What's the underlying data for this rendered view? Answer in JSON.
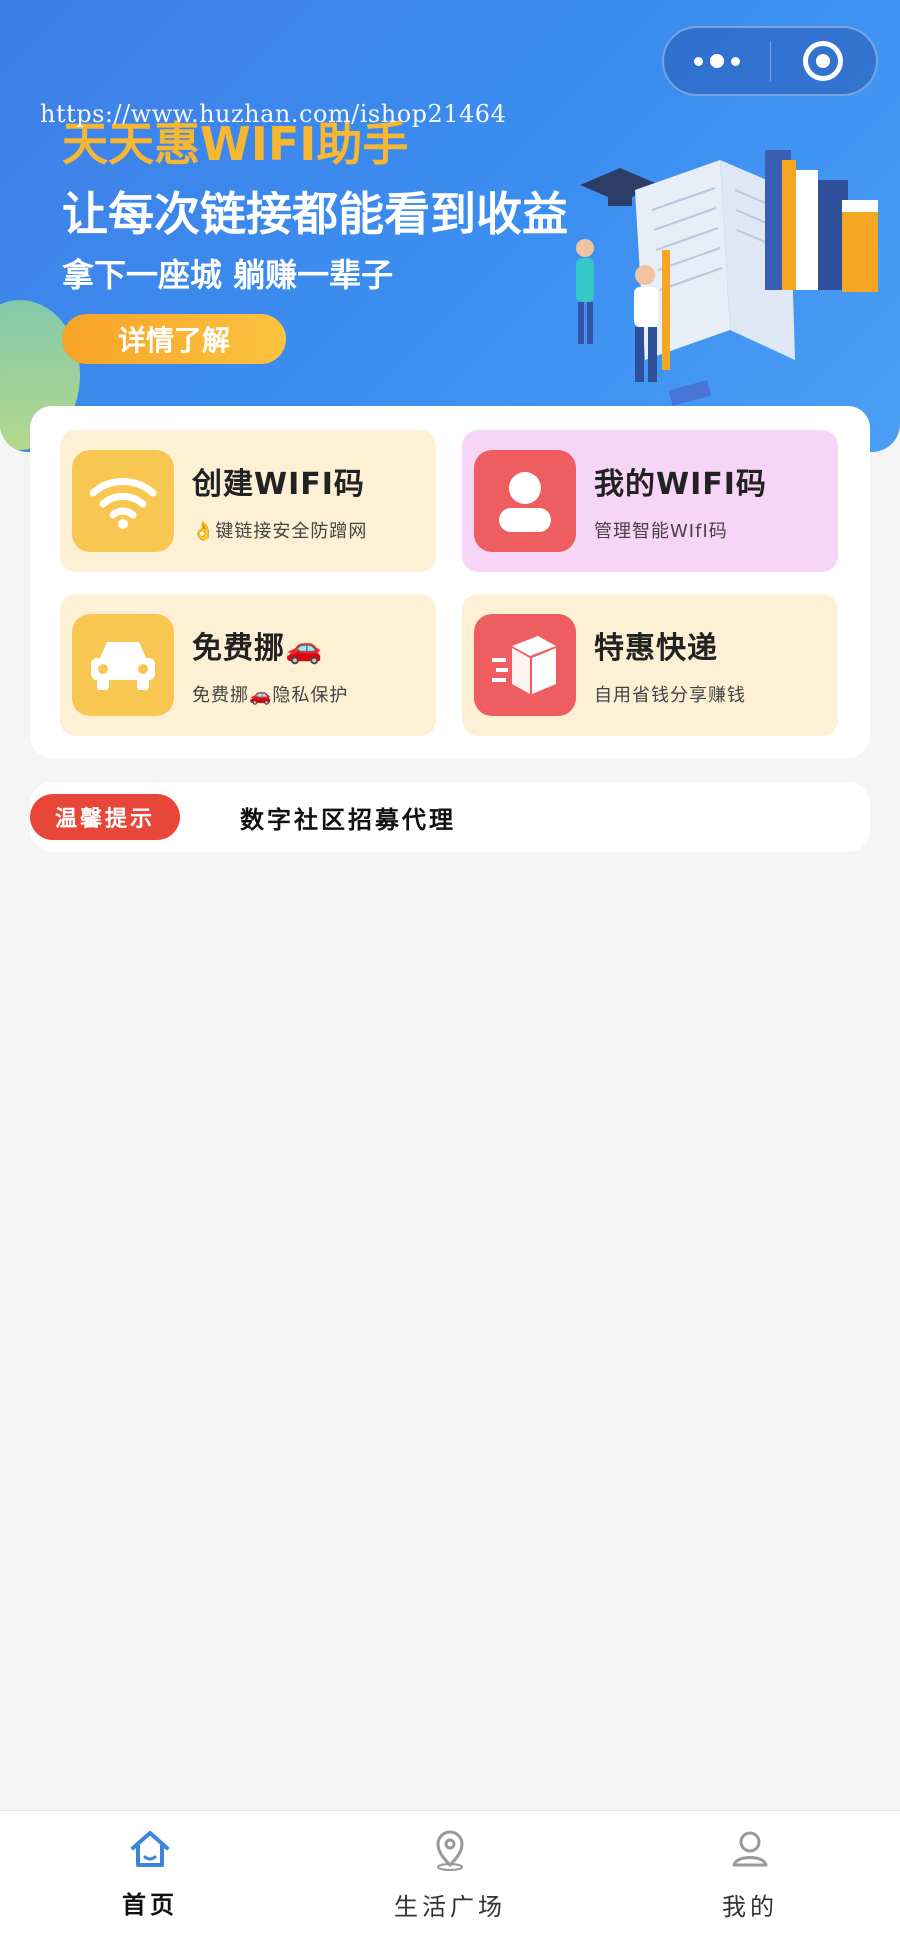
{
  "colors": {
    "banner_blue": "#3b8ef0",
    "accent_orange": "#f7a326",
    "tile_cream": "#fdf0d5",
    "tile_pink": "#f6d5f7",
    "icon_yellow": "#f8c752",
    "icon_red": "#ee5e60",
    "notice_red": "#e9463a",
    "tab_active_blue": "#3a83de"
  },
  "banner": {
    "watermark": "https://www.huzhan.com/ishop21464",
    "title": "天天惠WIFI助手",
    "subtitle": "让每次链接都能看到收益",
    "slogan": "拿下一座城 躺赚一辈子",
    "button_label": "详情了解"
  },
  "capsule": {
    "more_icon": "more-dots-icon",
    "close_icon": "target-icon"
  },
  "features": [
    {
      "title": "创建WIFI码",
      "desc": "👌键链接安全防蹭网",
      "icon": "wifi-icon"
    },
    {
      "title": "我的WIFI码",
      "desc": "管理智能WIfI码",
      "icon": "user-icon"
    },
    {
      "title": "免费挪🚗",
      "desc": "免费挪🚗隐私保护",
      "icon": "car-icon"
    },
    {
      "title": "特惠快递",
      "desc": "自用省钱分享赚钱",
      "icon": "package-icon"
    }
  ],
  "notice": {
    "tag": "温馨提示",
    "message": "数字社区招募代理"
  },
  "tabbar": {
    "items": [
      {
        "label": "首页",
        "icon": "home-icon",
        "active": true
      },
      {
        "label": "生活广场",
        "icon": "location-icon",
        "active": false
      },
      {
        "label": "我的",
        "icon": "profile-icon",
        "active": false
      }
    ]
  }
}
